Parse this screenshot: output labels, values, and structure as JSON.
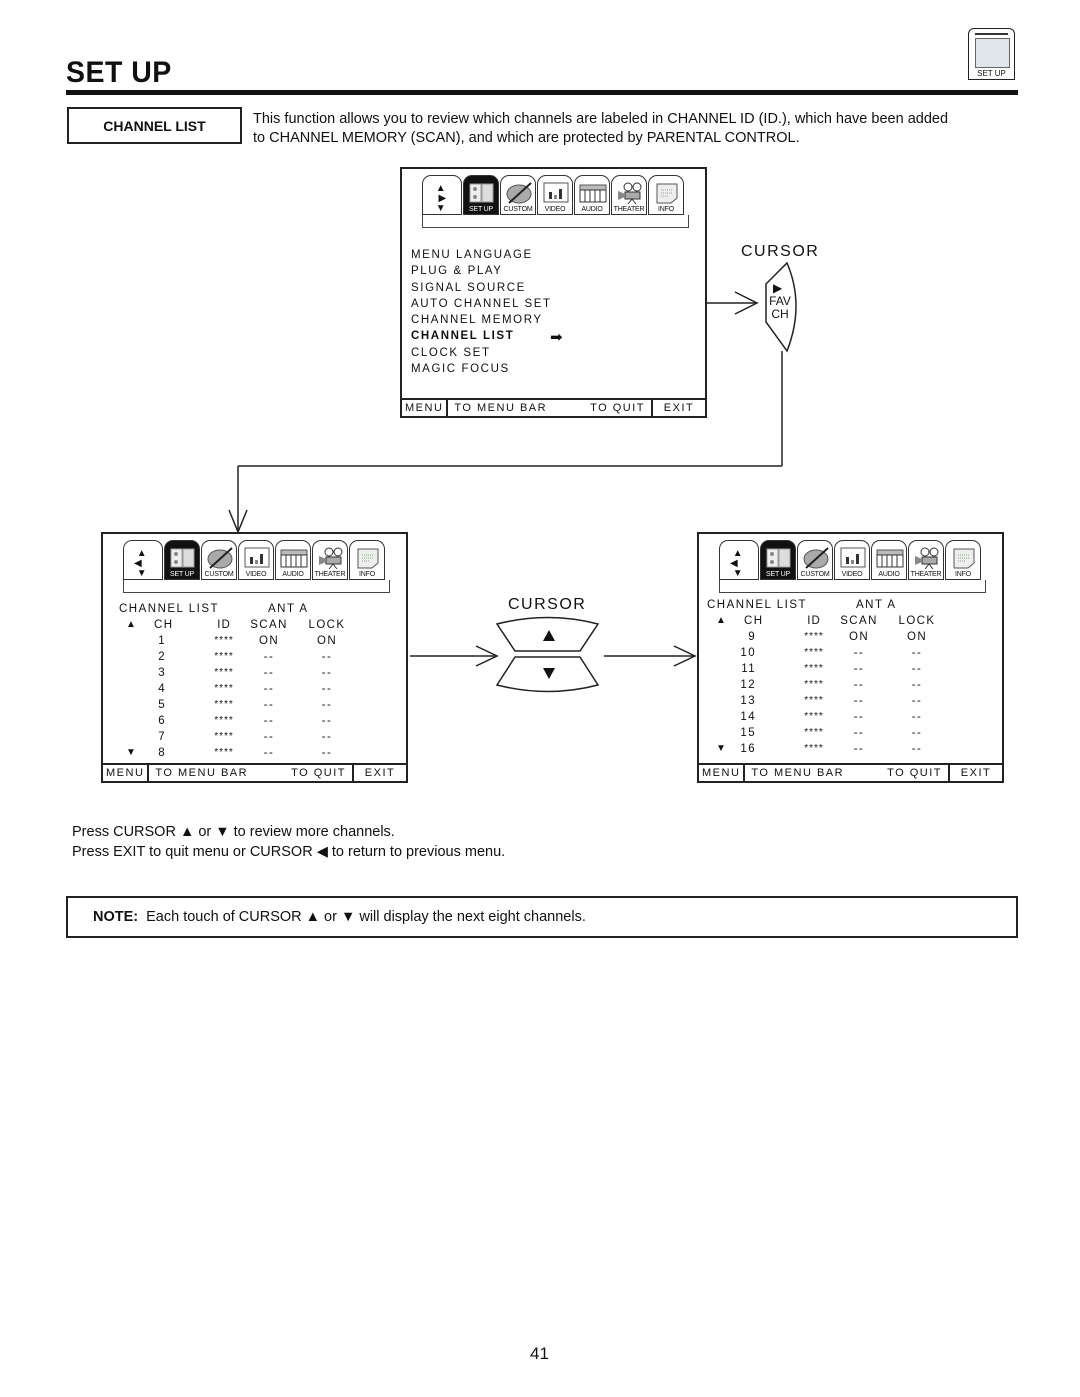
{
  "header": {
    "title": "SET UP",
    "icon_label": "SET UP"
  },
  "section": {
    "label": "CHANNEL LIST",
    "intro_line1": "This function allows you to review which channels are labeled in CHANNEL ID (ID.), which have been added",
    "intro_line2": "to CHANNEL MEMORY (SCAN), and which are protected by PARENTAL CONTROL."
  },
  "osd_tabs": [
    {
      "label": "",
      "icon": "cursor-arrows-icon"
    },
    {
      "label": "SET UP",
      "icon": "setup-icon",
      "active": true
    },
    {
      "label": "CUSTOM",
      "icon": "palette-icon"
    },
    {
      "label": "VIDEO",
      "icon": "video-icon"
    },
    {
      "label": "AUDIO",
      "icon": "keyboard-icon"
    },
    {
      "label": "THEATER",
      "icon": "projector-icon"
    },
    {
      "label": "INFO",
      "icon": "info-notepad-icon"
    }
  ],
  "setup_menu": {
    "items": [
      "MENU LANGUAGE",
      "PLUG & PLAY",
      "SIGNAL SOURCE",
      "AUTO CHANNEL SET",
      "CHANNEL MEMORY",
      "CHANNEL LIST",
      "CLOCK SET",
      "MAGIC FOCUS"
    ],
    "selected_index": 5
  },
  "menubar": {
    "menu": "MENU",
    "to_menu_bar": "TO MENU BAR",
    "to_quit": "TO QUIT",
    "exit": "EXIT"
  },
  "cursor_top": {
    "label": "CURSOR",
    "button_text1": "FAV",
    "button_text2": "CH"
  },
  "cursor_mid": {
    "label": "CURSOR"
  },
  "channel_list": {
    "title": "CHANNEL LIST",
    "antenna": "ANT A",
    "columns": [
      "CH",
      "ID",
      "SCAN",
      "LOCK"
    ],
    "page1": [
      {
        "ch": "1",
        "id": "****",
        "scan": "ON",
        "lock": "ON"
      },
      {
        "ch": "2",
        "id": "****",
        "scan": "--",
        "lock": "--"
      },
      {
        "ch": "3",
        "id": "****",
        "scan": "--",
        "lock": "--"
      },
      {
        "ch": "4",
        "id": "****",
        "scan": "--",
        "lock": "--"
      },
      {
        "ch": "5",
        "id": "****",
        "scan": "--",
        "lock": "--"
      },
      {
        "ch": "6",
        "id": "****",
        "scan": "--",
        "lock": "--"
      },
      {
        "ch": "7",
        "id": "****",
        "scan": "--",
        "lock": "--"
      },
      {
        "ch": "8",
        "id": "****",
        "scan": "--",
        "lock": "--"
      }
    ],
    "page2": [
      {
        "ch": "9",
        "id": "****",
        "scan": "ON",
        "lock": "ON"
      },
      {
        "ch": "10",
        "id": "****",
        "scan": "--",
        "lock": "--"
      },
      {
        "ch": "11",
        "id": "****",
        "scan": "--",
        "lock": "--"
      },
      {
        "ch": "12",
        "id": "****",
        "scan": "--",
        "lock": "--"
      },
      {
        "ch": "13",
        "id": "****",
        "scan": "--",
        "lock": "--"
      },
      {
        "ch": "14",
        "id": "****",
        "scan": "--",
        "lock": "--"
      },
      {
        "ch": "15",
        "id": "****",
        "scan": "--",
        "lock": "--"
      },
      {
        "ch": "16",
        "id": "****",
        "scan": "--",
        "lock": "--"
      }
    ]
  },
  "instructions": {
    "line1": "Press CURSOR ▲ or ▼ to review more channels.",
    "line2": "Press EXIT to quit menu or CURSOR ◀ to return to previous menu."
  },
  "note": {
    "label": "NOTE:",
    "text": "Each touch of CURSOR ▲ or ▼ will display the next eight channels."
  },
  "page_number": "41"
}
